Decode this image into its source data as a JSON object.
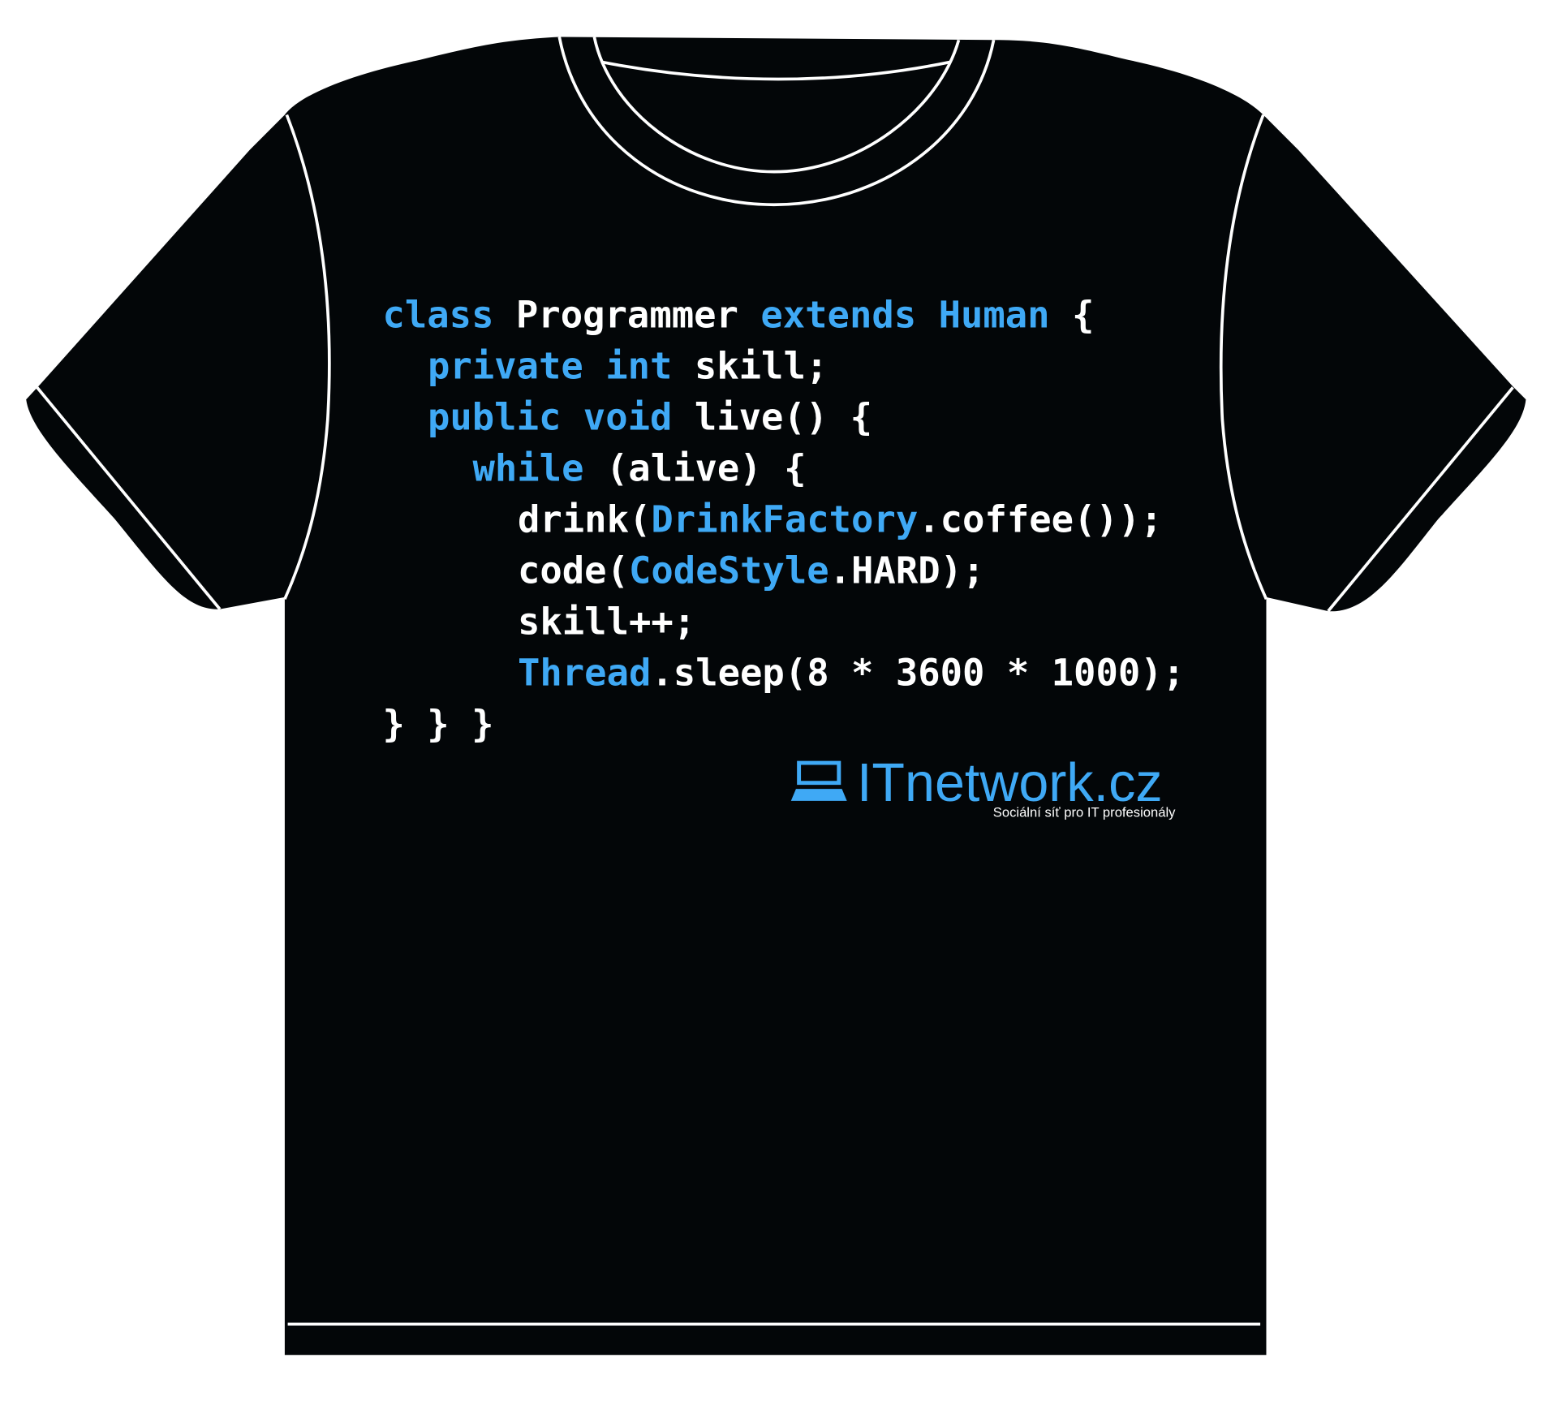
{
  "colors": {
    "shirt": "#030608",
    "outline": "#ffffff",
    "keyword": "#3fa9f5",
    "text": "#ffffff",
    "brand": "#3fa9f5"
  },
  "code_lines": [
    {
      "indent": 0,
      "tokens": [
        [
          "k",
          "class"
        ],
        [
          "t",
          " Programmer "
        ],
        [
          "k",
          "extends"
        ],
        [
          "t",
          " "
        ],
        [
          "k",
          "Human"
        ],
        [
          "t",
          " {"
        ]
      ]
    },
    {
      "indent": 2,
      "tokens": [
        [
          "k",
          "private"
        ],
        [
          "t",
          " "
        ],
        [
          "k",
          "int"
        ],
        [
          "t",
          " skill;"
        ]
      ]
    },
    {
      "indent": 2,
      "tokens": [
        [
          "k",
          "public"
        ],
        [
          "t",
          " "
        ],
        [
          "k",
          "void"
        ],
        [
          "t",
          " live() {"
        ]
      ]
    },
    {
      "indent": 4,
      "tokens": [
        [
          "k",
          "while"
        ],
        [
          "t",
          " (alive) {"
        ]
      ]
    },
    {
      "indent": 6,
      "tokens": [
        [
          "t",
          "drink("
        ],
        [
          "k",
          "DrinkFactory"
        ],
        [
          "t",
          ".coffee());"
        ]
      ]
    },
    {
      "indent": 6,
      "tokens": [
        [
          "t",
          "code("
        ],
        [
          "k",
          "CodeStyle"
        ],
        [
          "t",
          ".HARD);"
        ]
      ]
    },
    {
      "indent": 6,
      "tokens": [
        [
          "t",
          "skill++;"
        ]
      ]
    },
    {
      "indent": 6,
      "tokens": [
        [
          "k",
          "Thread"
        ],
        [
          "t",
          ".sleep(8 * 3600 * 1000);"
        ]
      ]
    },
    {
      "indent": 0,
      "tokens": [
        [
          "t",
          "} } }"
        ]
      ]
    }
  ],
  "logo": {
    "icon": "laptop-icon",
    "name": "ITnetwork.cz",
    "tagline": "Sociální síť pro IT profesionály"
  }
}
